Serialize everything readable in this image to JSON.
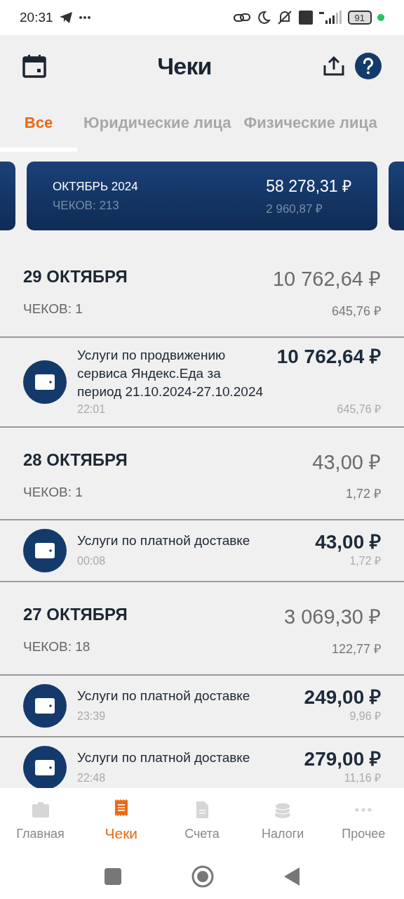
{
  "status_bar": {
    "time": "20:31",
    "battery": "91"
  },
  "header": {
    "title": "Чеки"
  },
  "tabs": [
    {
      "label": "Все",
      "selected": true
    },
    {
      "label": "Юридические лица",
      "selected": false
    },
    {
      "label": "Физические лица",
      "selected": false
    }
  ],
  "summary_card": {
    "month": "ОКТЯБРЬ 2024",
    "count": "ЧЕКОВ: 213",
    "total": "58 278,31 ₽",
    "tax": "2 960,87 ₽"
  },
  "days": [
    {
      "date": "29 ОКТЯБРЯ",
      "count": "ЧЕКОВ: 1",
      "total": "10 762,64 ₽",
      "tax": "645,76 ₽",
      "receipts": [
        {
          "title": "Услуги по продвижению сервиса Яндекс.Еда за период 21.10.2024-27.10.2024",
          "time": "22:01",
          "amount": "10 762,64 ₽",
          "tax": "645,76 ₽"
        }
      ]
    },
    {
      "date": "28 ОКТЯБРЯ",
      "count": "ЧЕКОВ: 1",
      "total": "43,00 ₽",
      "tax": "1,72 ₽",
      "receipts": [
        {
          "title": "Услуги по платной доставке",
          "time": "00:08",
          "amount": "43,00 ₽",
          "tax": "1,72 ₽"
        }
      ]
    },
    {
      "date": "27 ОКТЯБРЯ",
      "count": "ЧЕКОВ: 18",
      "total": "3 069,30 ₽",
      "tax": "122,77 ₽",
      "receipts": [
        {
          "title": "Услуги по платной доставке",
          "time": "23:39",
          "amount": "249,00 ₽",
          "tax": "9,96 ₽"
        },
        {
          "title": "Услуги по платной доставке",
          "time": "22:48",
          "amount": "279,00 ₽",
          "tax": "11,16 ₽"
        }
      ]
    }
  ],
  "bottom_nav": [
    {
      "label": "Главная",
      "kind": "home",
      "selected": false
    },
    {
      "label": "Чеки",
      "kind": "receipts",
      "selected": true
    },
    {
      "label": "Счета",
      "kind": "invoices",
      "selected": false
    },
    {
      "label": "Налоги",
      "kind": "taxes",
      "selected": false
    },
    {
      "label": "Прочее",
      "kind": "more",
      "selected": false
    }
  ]
}
